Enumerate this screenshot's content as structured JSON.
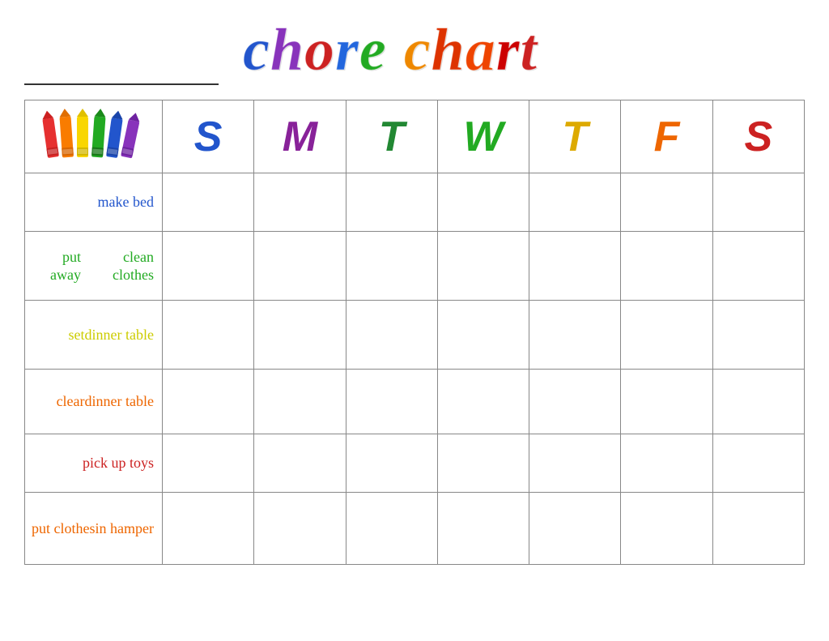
{
  "header": {
    "title_word1": "chore",
    "title_word2": "chart",
    "name_placeholder": ""
  },
  "days": {
    "headers": [
      {
        "label": "S",
        "color": "#2255cc"
      },
      {
        "label": "M",
        "color": "#882299"
      },
      {
        "label": "T",
        "color": "#228833"
      },
      {
        "label": "W",
        "color": "#22aa22"
      },
      {
        "label": "T",
        "color": "#ddaa00"
      },
      {
        "label": "F",
        "color": "#ee6600"
      },
      {
        "label": "S",
        "color": "#cc2222"
      }
    ]
  },
  "chores": [
    {
      "label": "make bed",
      "color": "#2255cc",
      "multiline": false
    },
    {
      "label": "put away\nclean clothes",
      "color": "#22aa22",
      "multiline": true
    },
    {
      "label": "set\ndinner table",
      "color": "#cccc00",
      "multiline": true
    },
    {
      "label": "clear\ndinner table",
      "color": "#ee6600",
      "multiline": true
    },
    {
      "label": "pick up toys",
      "color": "#cc2222",
      "multiline": false
    },
    {
      "label": "put clothes\nin hamper",
      "color": "#ee6600",
      "multiline": true
    }
  ],
  "title_letters": [
    {
      "ch": "c",
      "color": "#2255cc"
    },
    {
      "ch": "h",
      "color": "#8833bb"
    },
    {
      "ch": "o",
      "color": "#cc2222"
    },
    {
      "ch": "r",
      "color": "#2266dd"
    },
    {
      "ch": "e",
      "color": "#22aa22"
    },
    {
      "ch": " ",
      "color": "transparent"
    },
    {
      "ch": "c",
      "color": "#ee8800"
    },
    {
      "ch": "h",
      "color": "#dd3300"
    },
    {
      "ch": "a",
      "color": "#ee4400"
    },
    {
      "ch": "r",
      "color": "#cc0000"
    },
    {
      "ch": "t",
      "color": "#cc2222"
    }
  ]
}
